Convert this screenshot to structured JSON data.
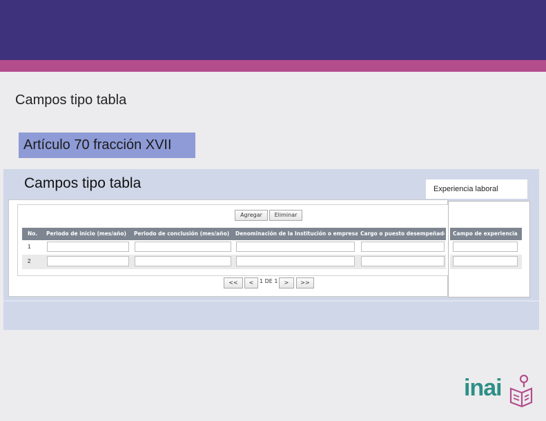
{
  "slide": {
    "heading": "Campos tipo tabla",
    "article": "Artículo 70 fracción XVII"
  },
  "panel": {
    "title": "Campos tipo tabla",
    "experience_label": "Experiencia laboral"
  },
  "toolbar": {
    "add_label": "Agregar",
    "delete_label": "Eliminar"
  },
  "table": {
    "columns": [
      "No.",
      "Periodo de inicio (mes/año)",
      "Periodo de conclusión (mes/año)",
      "Denominación de la Institución o empresa",
      "Cargo o puesto desempeñado"
    ],
    "rows": [
      {
        "num": "1"
      },
      {
        "num": "2"
      }
    ],
    "side_column": "Campo de experiencia"
  },
  "pager": {
    "first": "<<",
    "prev": "<",
    "page_text": "1 DE 1",
    "next": ">",
    "last": ">>"
  },
  "logo": {
    "text": "inai"
  },
  "colors": {
    "top_band": "#3e327c",
    "accent_band": "#b44d8c",
    "article_box": "#8e9bd6",
    "panel": "#cfd7e8",
    "table_header": "#7d8591",
    "logo": "#2d8f86"
  }
}
